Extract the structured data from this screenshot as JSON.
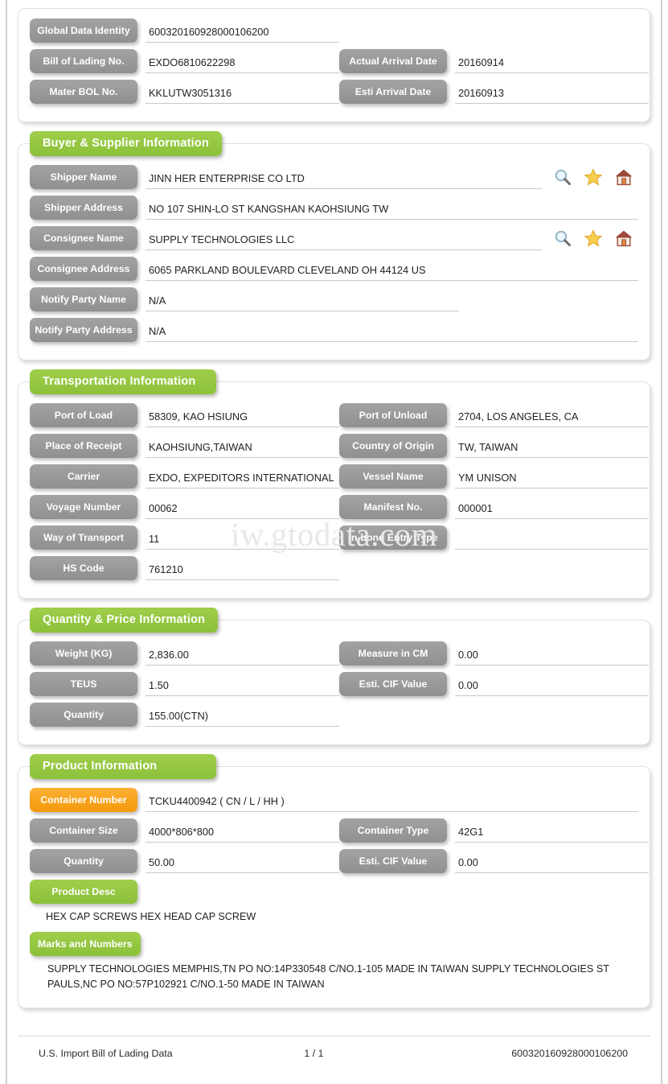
{
  "document": {
    "footer_left": "U.S. Import Bill of Lading Data",
    "footer_page": "1 / 1",
    "footer_right": "600320160928000106200",
    "watermark": "iw.gtodata.com"
  },
  "identity": {
    "fields": [
      {
        "label": "Global Data Identity",
        "value": "600320160928000106200"
      },
      {
        "label": "Bill of Lading No.",
        "value": "EXDO6810622298"
      },
      {
        "label": "Mater BOL No.",
        "value": "KKLUTW3051316"
      }
    ],
    "right_fields": [
      {
        "label": "Actual Arrival Date",
        "value": "20160914"
      },
      {
        "label": "Esti Arrival Date",
        "value": "20160913"
      }
    ]
  },
  "buyer_supplier": {
    "title": "Buyer & Supplier Information",
    "fields": [
      {
        "label": "Shipper Name",
        "value": "JINN HER ENTERPRISE CO LTD"
      },
      {
        "label": "Shipper Address",
        "value": "NO 107 SHIN-LO ST KANGSHAN KAOHSIUNG TW"
      },
      {
        "label": "Consignee Name",
        "value": "SUPPLY TECHNOLOGIES LLC"
      },
      {
        "label": "Consignee Address",
        "value": "6065 PARKLAND BOULEVARD CLEVELAND OH 44124 US"
      },
      {
        "label": "Notify Party Name",
        "value": "N/A"
      },
      {
        "label": "Notify Party Address",
        "value": "N/A"
      }
    ],
    "icons": [
      "search-icon",
      "star-icon",
      "home-icon"
    ]
  },
  "transportation": {
    "title": "Transportation Information",
    "left_fields": [
      {
        "label": "Port of Load",
        "value": "58309, KAO HSIUNG"
      },
      {
        "label": "Place of Receipt",
        "value": "KAOHSIUNG,TAIWAN"
      },
      {
        "label": "Carrier",
        "value": "EXDO, EXPEDITORS INTERNATIONAL"
      },
      {
        "label": "Voyage Number",
        "value": "00062"
      },
      {
        "label": "Way of Transport",
        "value": "11"
      },
      {
        "label": "HS Code",
        "value": "761210"
      }
    ],
    "right_fields": [
      {
        "label": "Port of Unload",
        "value": "2704, LOS ANGELES, CA"
      },
      {
        "label": "Country of Origin",
        "value": "TW, TAIWAN"
      },
      {
        "label": "Vessel Name",
        "value": "YM UNISON"
      },
      {
        "label": "Manifest No.",
        "value": "000001"
      },
      {
        "label": "In-bond Entry Type",
        "value": ""
      }
    ]
  },
  "quantity_price": {
    "title": "Quantity & Price Information",
    "left_fields": [
      {
        "label": "Weight (KG)",
        "value": "2,836.00"
      },
      {
        "label": "TEUS",
        "value": "1.50"
      },
      {
        "label": "Quantity",
        "value": "155.00(CTN)"
      }
    ],
    "right_fields": [
      {
        "label": "Measure in CM",
        "value": "0.00"
      },
      {
        "label": "Esti. CIF Value",
        "value": "0.00"
      }
    ]
  },
  "product": {
    "title": "Product Information",
    "container_number": {
      "label": "Container Number",
      "value": "TCKU4400942 ( CN / L / HH )"
    },
    "left_fields": [
      {
        "label": "Container Size",
        "value": "4000*806*800"
      },
      {
        "label": "Quantity",
        "value": "50.00"
      }
    ],
    "right_fields": [
      {
        "label": "Container Type",
        "value": "42G1"
      },
      {
        "label": "Esti. CIF Value",
        "value": "0.00"
      }
    ],
    "product_desc": {
      "label": "Product Desc",
      "text": "HEX CAP SCREWS HEX HEAD CAP SCREW"
    },
    "marks": {
      "label": "Marks and Numbers",
      "text": "SUPPLY TECHNOLOGIES MEMPHIS,TN PO NO:14P330548 C/NO.1-105 MADE IN TAIWAN SUPPLY TECHNOLOGIES ST PAULS,NC PO NO:57P102921 C/NO.1-50 MADE IN TAIWAN"
    }
  },
  "colors": {
    "green": "#8cc13a",
    "gray": "#999999",
    "orange": "#f59a0c"
  }
}
